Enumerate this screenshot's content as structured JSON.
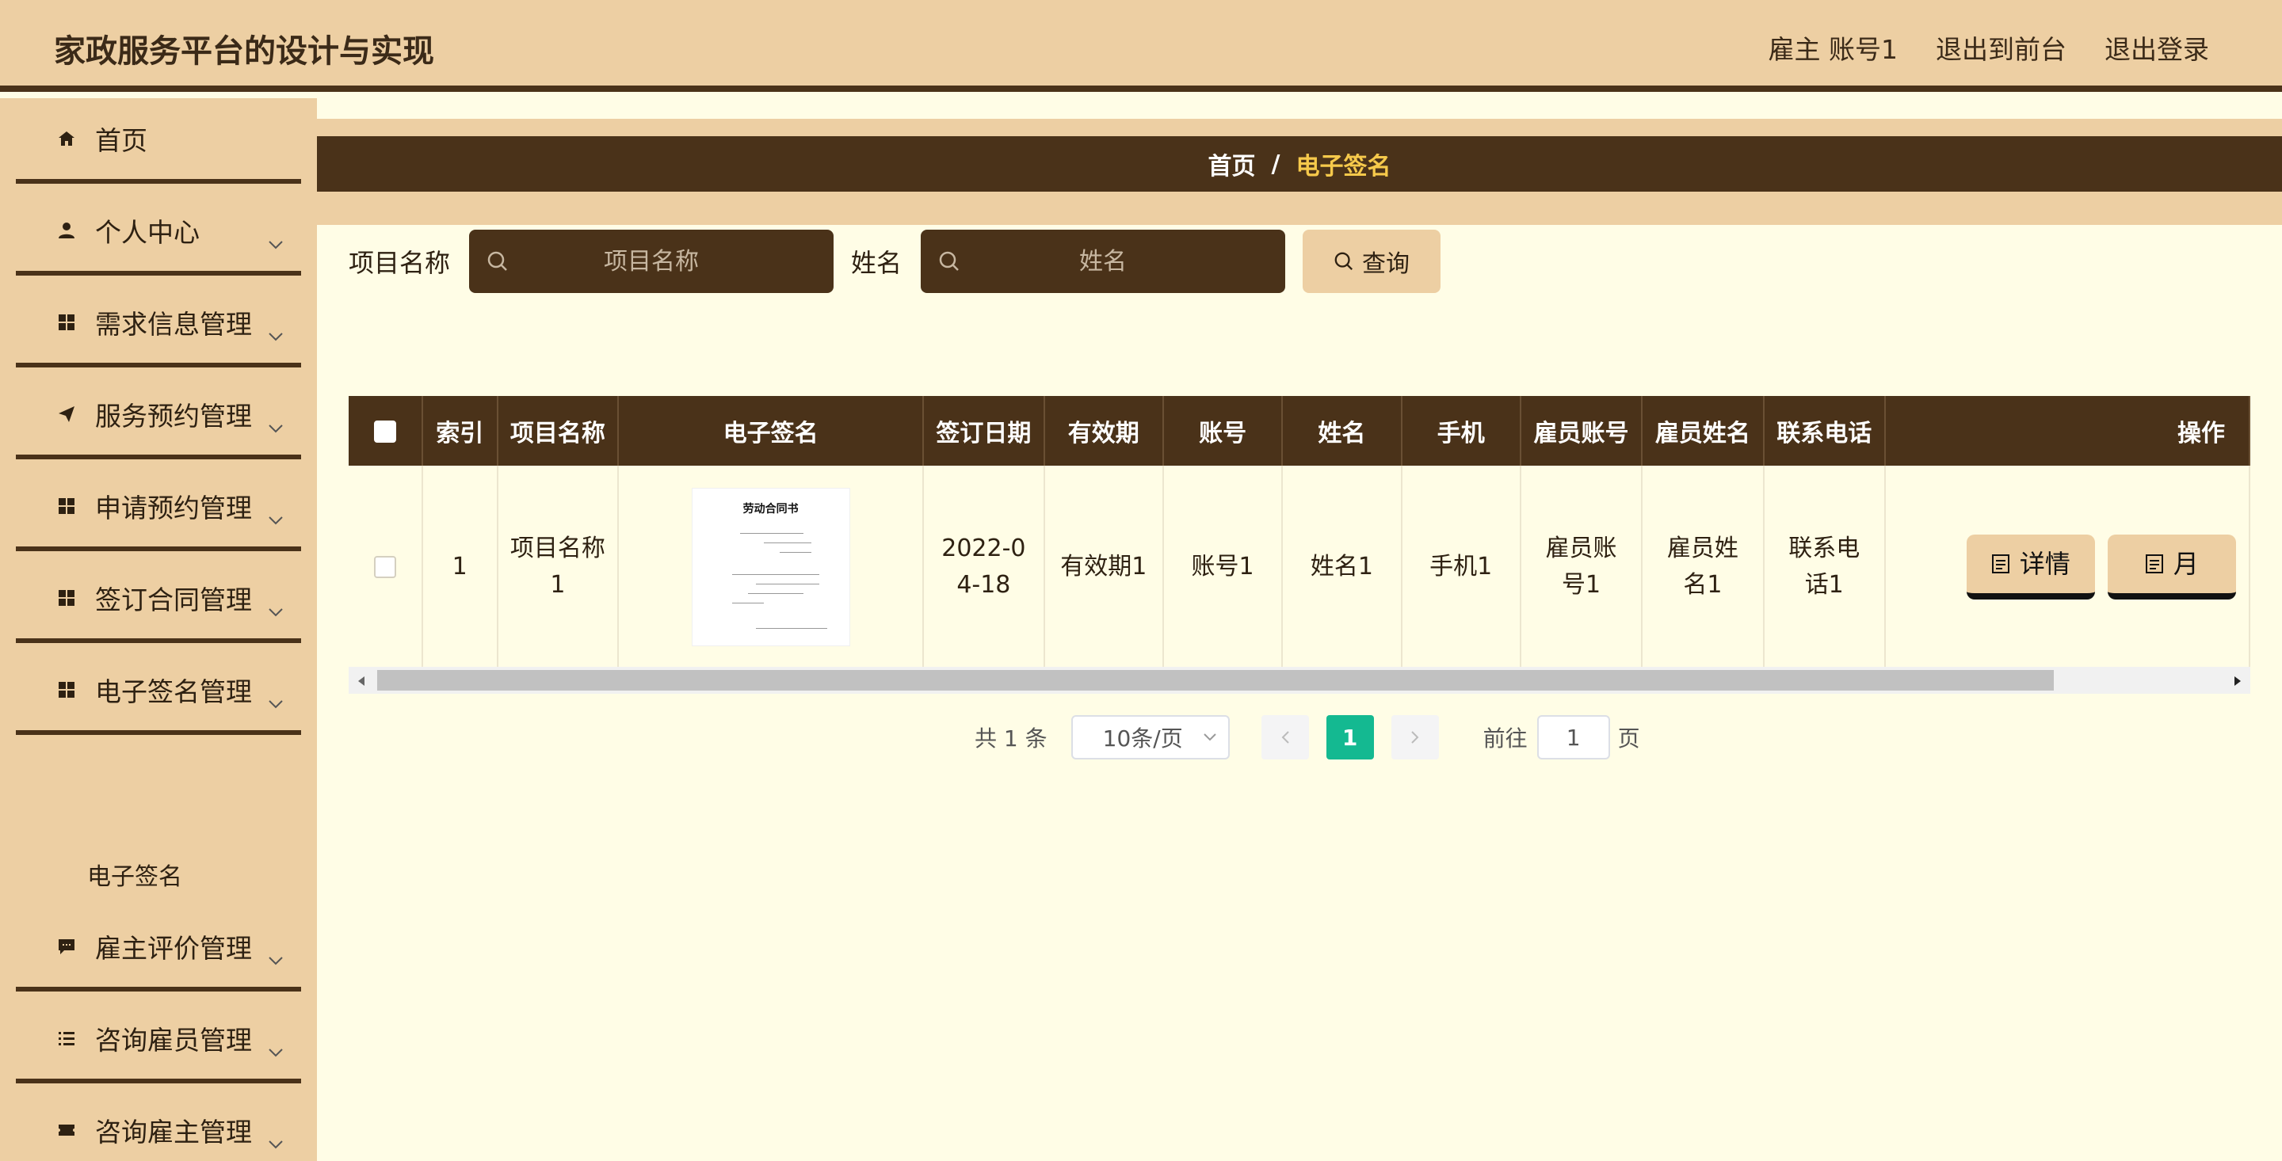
{
  "header": {
    "title": "家政服务平台的设计与实现",
    "user": "雇主 账号1",
    "exit_front": "退出到前台",
    "logout": "退出登录"
  },
  "sidebar": {
    "items": [
      {
        "label": "首页",
        "icon": "home-icon"
      },
      {
        "label": "个人中心",
        "icon": "user-icon"
      },
      {
        "label": "需求信息管理",
        "icon": "grid-icon"
      },
      {
        "label": "服务预约管理",
        "icon": "send-icon"
      },
      {
        "label": "申请预约管理",
        "icon": "grid-icon"
      },
      {
        "label": "签订合同管理",
        "icon": "grid-icon"
      },
      {
        "label": "电子签名管理",
        "icon": "grid-icon"
      },
      {
        "label": "雇主评价管理",
        "icon": "comment-icon"
      },
      {
        "label": "咨询雇员管理",
        "icon": "list-icon"
      },
      {
        "label": "咨询雇主管理",
        "icon": "ticket-icon"
      }
    ],
    "submenu_active": "电子签名"
  },
  "breadcrumb": {
    "home": "首页",
    "separator": "/",
    "current": "电子签名"
  },
  "search": {
    "label1": "项目名称",
    "placeholder1": "项目名称",
    "label2": "姓名",
    "placeholder2": "姓名",
    "button": "查询"
  },
  "table": {
    "headers": [
      "索引",
      "项目名称",
      "电子签名",
      "签订日期",
      "有效期",
      "账号",
      "姓名",
      "手机",
      "雇员账号",
      "雇员姓名",
      "联系电话",
      "操作"
    ],
    "rows": [
      {
        "index": "1",
        "project": "项目名称1",
        "signature_doc_title": "劳动合同书",
        "date": "2022-04-18",
        "validity": "有效期1",
        "account": "账号1",
        "name": "姓名1",
        "phone": "手机1",
        "employee_account": "雇员账号1",
        "employee_name": "雇员姓名1",
        "contact_phone": "联系电话1",
        "actions": [
          "详情",
          "月"
        ]
      }
    ]
  },
  "pagination": {
    "total": "共 1 条",
    "page_size": "10条/页",
    "current_page": "1",
    "goto_label": "前往",
    "goto_value": "1",
    "page_suffix": "页"
  },
  "colors": {
    "header_bg": "#edcfa3",
    "dark_brown": "#4a3219",
    "content_bg": "#fffde6",
    "accent_yellow": "#f6c94b",
    "page_active": "#14b991"
  }
}
